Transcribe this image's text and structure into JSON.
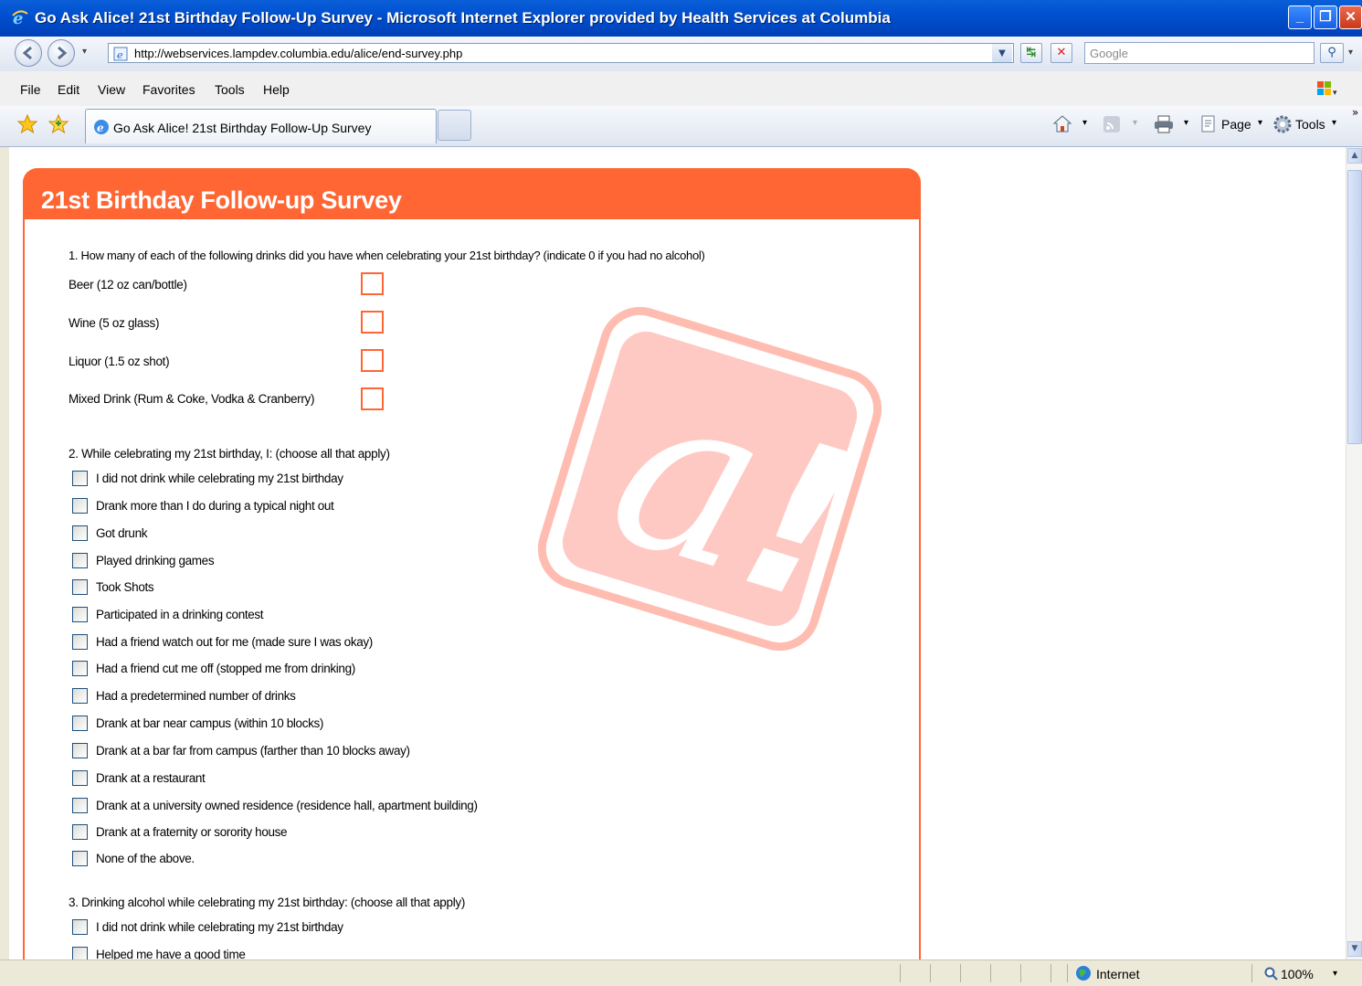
{
  "window": {
    "title": "Go Ask Alice! 21st Birthday Follow-Up Survey - Microsoft Internet Explorer provided by Health Services at Columbia"
  },
  "address_bar": {
    "url": "http://webservices.lampdev.columbia.edu/alice/end-survey.php",
    "search_placeholder": "Google"
  },
  "menu": {
    "items": [
      "File",
      "Edit",
      "View",
      "Favorites",
      "Tools",
      "Help"
    ]
  },
  "tabs": {
    "active_label": "Go Ask Alice! 21st Birthday Follow-Up Survey"
  },
  "command_bar": {
    "page_label": "Page",
    "tools_label": "Tools"
  },
  "survey": {
    "title": "21st Birthday Follow-up Survey",
    "q1": {
      "text": "1. How many of each of the following drinks did you have when celebrating your 21st birthday? (indicate 0 if you had no alcohol)",
      "items": [
        "Beer (12 oz can/bottle)",
        "Wine (5 oz glass)",
        "Liquor (1.5 oz shot)",
        "Mixed Drink (Rum & Coke, Vodka & Cranberry)"
      ]
    },
    "q2": {
      "text": "2. While celebrating my 21st birthday, I: (choose all that apply)",
      "options": [
        "I did not drink while celebrating my 21st birthday",
        "Drank more than I do during a typical night out",
        "Got drunk",
        "Played drinking games",
        "Took Shots",
        "Participated in a drinking contest",
        "Had a friend watch out for me (made sure I was okay)",
        "Had a friend cut me off (stopped me from drinking)",
        "Had a predetermined number of drinks",
        "Drank at bar near campus (within 10 blocks)",
        "Drank at a bar far from campus (farther than 10 blocks away)",
        "Drank at a restaurant",
        "Drank at a university owned residence (residence hall, apartment building)",
        "Drank at a fraternity or sorority house",
        "None of the above."
      ]
    },
    "q3": {
      "text": "3. Drinking alcohol while celebrating my 21st birthday: (choose all that apply)",
      "options": [
        "I did not drink while celebrating my 21st birthday",
        "Helped me have a good time"
      ]
    }
  },
  "status_bar": {
    "zone": "Internet",
    "zoom": "100%"
  },
  "colors": {
    "accent": "#ff6633",
    "titlebar": "#0054e3"
  }
}
